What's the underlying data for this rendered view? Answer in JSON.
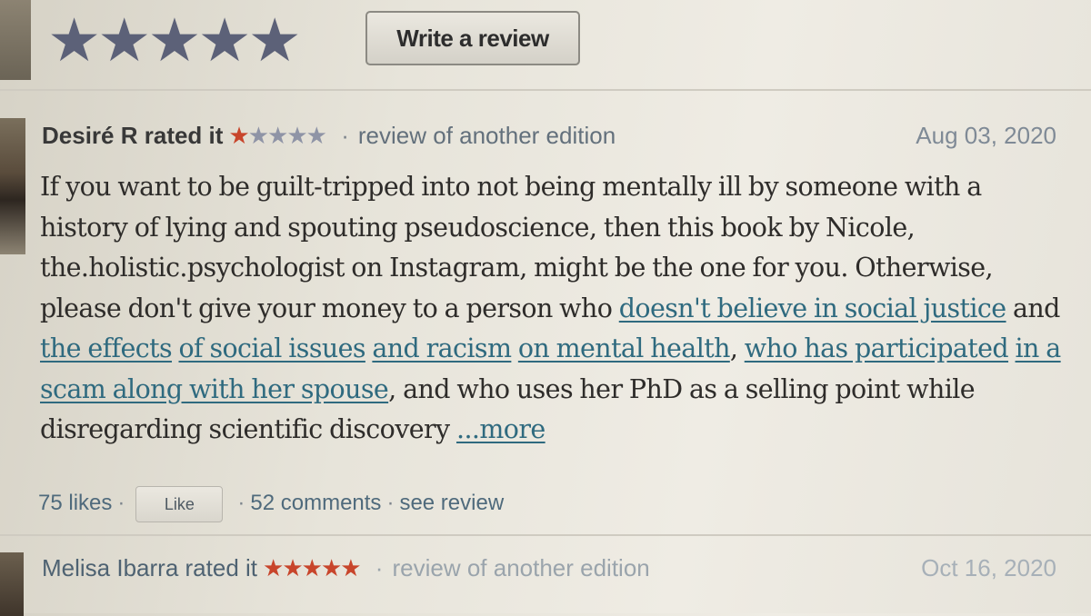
{
  "rating_widget": {
    "stars": "★★★★★",
    "write_review_label": "Write a review"
  },
  "reviews": [
    {
      "reviewer": "Desiré R",
      "rated_text": "rated it",
      "stars_on": "★",
      "stars_off": "★★★★",
      "separator": "·",
      "edition_text": "review of another edition",
      "date": "Aug 03, 2020",
      "body": {
        "s1": "If you want to be guilt-tripped into not being mentally ill by someone with a history of lying and spouting pseudoscience, then this book by Nicole, the.holistic.psychologist on Instagram, might be the one for you. Otherwise, please don't give your money to a person who ",
        "link1": "doesn't believe in social justice",
        "s2": " and ",
        "link2": "the effects",
        "s3": " ",
        "link3": "of social issues",
        "s4": " ",
        "link4": "and racism",
        "s5": " ",
        "link5": "on mental health",
        "s6": ", ",
        "link6": "who has participated",
        "s7": " ",
        "link7": "in a scam along with her spouse",
        "s8": ", and who uses her PhD as a selling point while disregarding scientific discovery ",
        "more": "...more"
      },
      "likes": "75 likes",
      "dot": "·",
      "like_button": "Like",
      "comments": "52 comments",
      "see_review": "see review"
    },
    {
      "reviewer": "Melisa Ibarra",
      "rated_text": "rated it",
      "stars_on": "★★★★★",
      "separator": "·",
      "edition_text": "review of another edition",
      "date": "Oct 16, 2020"
    }
  ],
  "colors": {
    "star_rated": "#c8452b",
    "star_empty": "#8f94a6",
    "link": "#2f6a7f",
    "meta_link": "#4f6a7c"
  }
}
